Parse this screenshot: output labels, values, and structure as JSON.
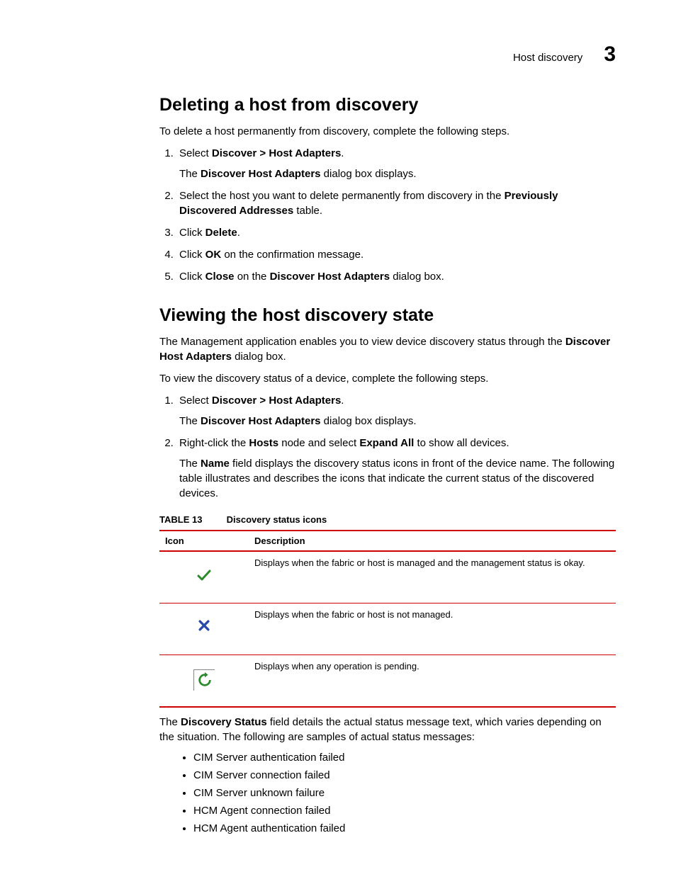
{
  "header": {
    "label": "Host discovery",
    "chapter": "3"
  },
  "sectionA": {
    "title": "Deleting a host from discovery",
    "intro": "To delete a host permanently from discovery, complete the following steps.",
    "steps": {
      "s1a": "Select ",
      "s1b": "Discover > Host Adapters",
      "s1_sub_a": "The ",
      "s1_sub_b": "Discover Host Adapters",
      "s1_sub_c": " dialog box displays.",
      "s2a": "Select the host you want to delete permanently from discovery in the ",
      "s2b": "Previously Discovered Addresses",
      "s2c": " table.",
      "s3a": "Click ",
      "s3b": "Delete",
      "s4a": "Click ",
      "s4b": "OK",
      "s4c": " on the confirmation message.",
      "s5a": "Click ",
      "s5b": "Close",
      "s5c": " on the ",
      "s5d": "Discover Host Adapters",
      "s5e": " dialog box."
    }
  },
  "sectionB": {
    "title": "Viewing the host discovery state",
    "intro_a": "The Management application enables you to view device discovery status through the ",
    "intro_b": "Discover Host Adapters",
    "intro_c": " dialog box.",
    "lead": "To view the discovery status of a device, complete the following steps.",
    "steps": {
      "s1a": "Select ",
      "s1b": "Discover > Host Adapters",
      "s1_sub_a": "The ",
      "s1_sub_b": "Discover Host Adapters",
      "s1_sub_c": " dialog box displays.",
      "s2a": "Right-click the ",
      "s2b": "Hosts",
      "s2c": " node and select ",
      "s2d": "Expand All",
      "s2e": " to show all devices.",
      "s2_sub_a": "The ",
      "s2_sub_b": "Name",
      "s2_sub_c": " field displays the discovery status icons in front of the device name. The following table illustrates and describes the icons that indicate the current status of the discovered devices."
    }
  },
  "table": {
    "number": "TABLE 13",
    "caption": "Discovery status icons",
    "col1": "Icon",
    "col2": "Description",
    "rows": [
      {
        "icon": "check",
        "desc": "Displays when the fabric or host is managed and the management status is okay."
      },
      {
        "icon": "x",
        "desc": "Displays when the fabric or host is not managed."
      },
      {
        "icon": "refresh",
        "desc": "Displays when any operation is pending."
      }
    ]
  },
  "afterTable": {
    "para_a": "The ",
    "para_b": "Discovery Status",
    "para_c": " field details the actual status message text, which varies depending on the situation. The following are samples of actual status messages:",
    "items": [
      "CIM Server authentication failed",
      "CIM Server connection failed",
      "CIM Server unknown failure",
      "HCM Agent connection failed",
      "HCM Agent authentication failed"
    ]
  }
}
